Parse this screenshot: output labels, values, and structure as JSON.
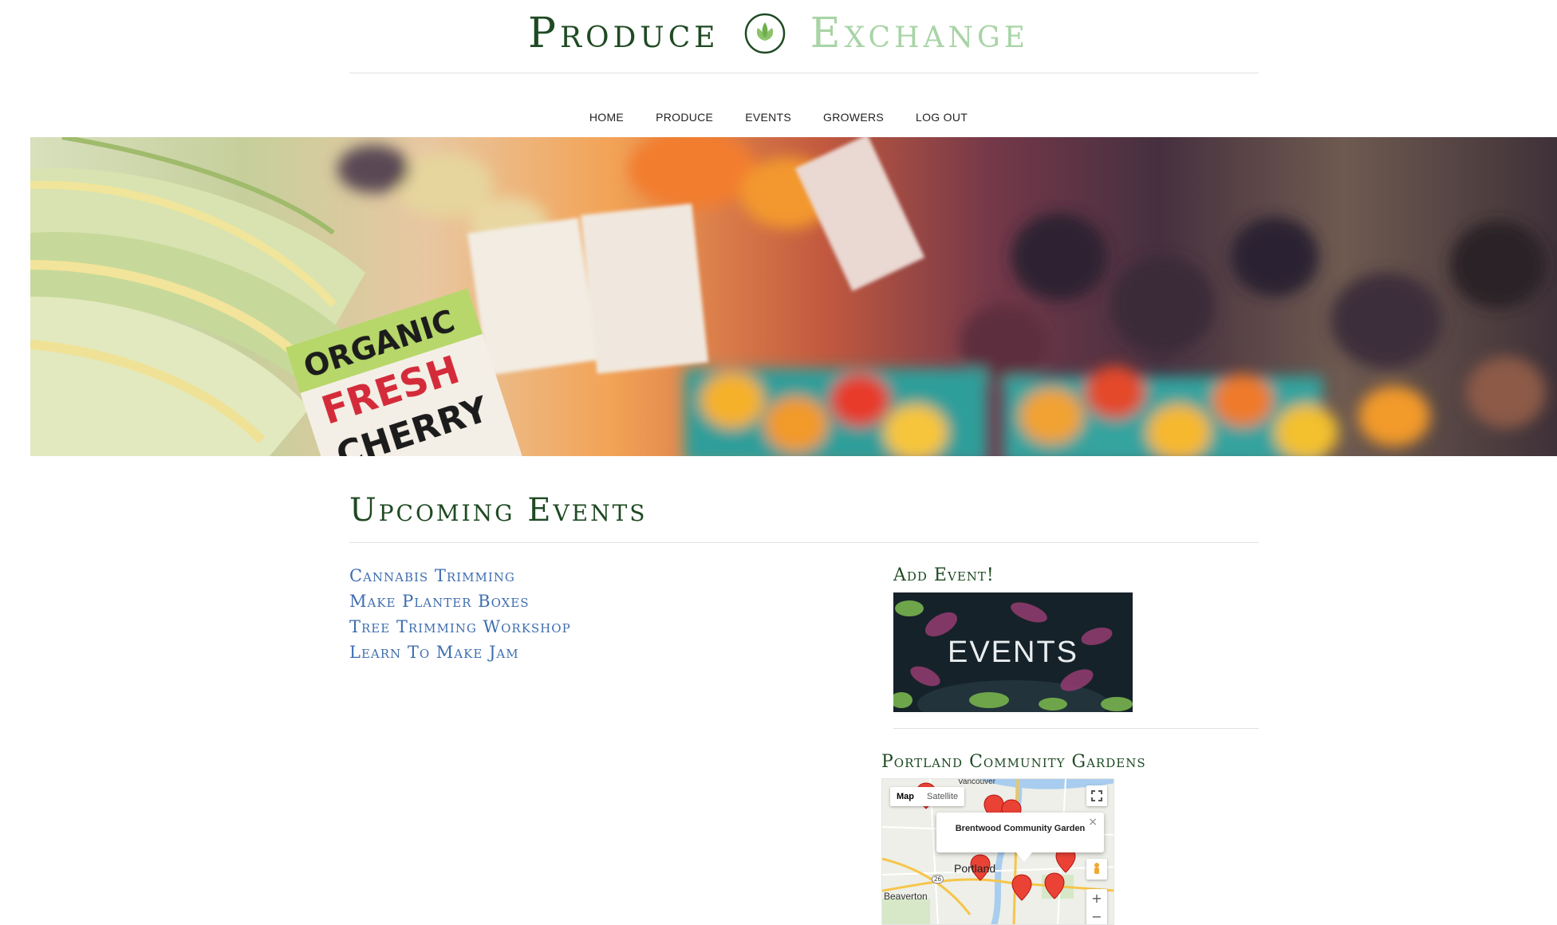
{
  "brand": {
    "word1": "Produce",
    "word2": "Exchange",
    "logo_icon": "leaf-icon",
    "colors": {
      "dark_green": "#1f4a23",
      "light_green": "#a8d4a6",
      "link_blue": "#3f6eb0"
    }
  },
  "nav": {
    "items": [
      {
        "label": "HOME"
      },
      {
        "label": "PRODUCE"
      },
      {
        "label": "EVENTS"
      },
      {
        "label": "GROWERS"
      },
      {
        "label": "LOG OUT"
      }
    ]
  },
  "hero": {
    "sign_line1": "ORGANIC",
    "sign_line2": "FRESH",
    "sign_line3": "CHERRY"
  },
  "main": {
    "title": "Upcoming Events",
    "events": [
      {
        "label": "Cannabis Trimming"
      },
      {
        "label": "Make Planter Boxes"
      },
      {
        "label": "Tree Trimming Workshop"
      },
      {
        "label": "Learn To Make Jam"
      }
    ]
  },
  "sidebar": {
    "add_event_title": "Add Event!",
    "add_event_image_text": "EVENTS",
    "gardens_title": "Portland Community Gardens",
    "map": {
      "type_map": "Map",
      "type_satellite": "Satellite",
      "infowindow_title": "Brentwood Community Garden",
      "close_glyph": "×",
      "zoom_in": "+",
      "zoom_out": "−",
      "label_portland": "Portland",
      "label_beaverton": "Beaverton",
      "label_vancouver": "Vancouver",
      "label_highway": "26",
      "fullscreen_icon": "fullscreen-icon",
      "pegman_icon": "pegman-icon",
      "marker_icon": "map-marker-icon"
    }
  }
}
